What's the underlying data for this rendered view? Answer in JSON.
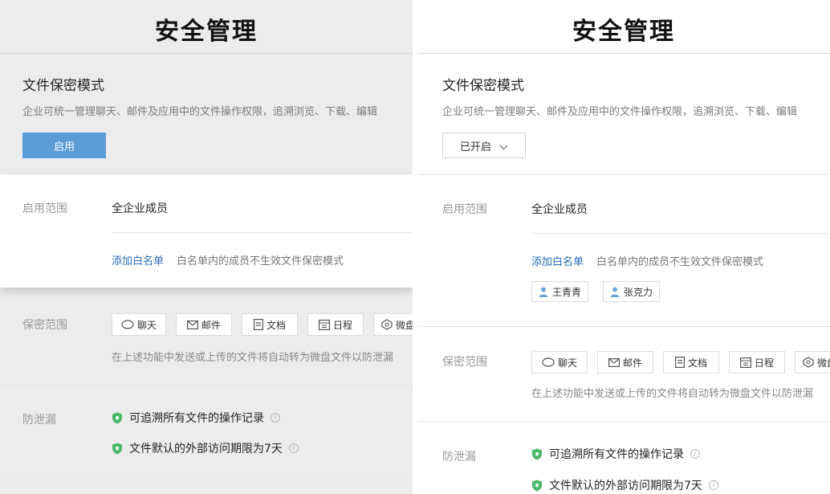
{
  "page_title": "安全管理",
  "file_mode": {
    "title": "文件保密模式",
    "description": "企业可统一管理聊天、邮件及应用中的文件操作权限，追溯浏览、下载、编辑"
  },
  "left": {
    "enable_button": "启用"
  },
  "right": {
    "status_dropdown": "已开启",
    "whitelist_users": [
      "王青青",
      "张克力"
    ]
  },
  "scope": {
    "label": "启用范围",
    "value": "全企业成员",
    "add_whitelist": "添加白名单",
    "whitelist_note": "白名单内的成员不生效文件保密模式"
  },
  "secrecy": {
    "label": "保密范围",
    "items": [
      "聊天",
      "邮件",
      "文档",
      "日程",
      "微盘"
    ],
    "note": "在上述功能中发送或上传的文件将自动转为微盘文件以防泄漏"
  },
  "leakproof": {
    "label": "防泄漏",
    "features": [
      "可追溯所有文件的操作记录",
      "文件默认的外部访问期限为7天"
    ]
  },
  "colors": {
    "accent": "#5b9bd6",
    "link": "#2a6cb8",
    "shield_green": "#4cb86a",
    "user_icon": "#6fa3db"
  }
}
